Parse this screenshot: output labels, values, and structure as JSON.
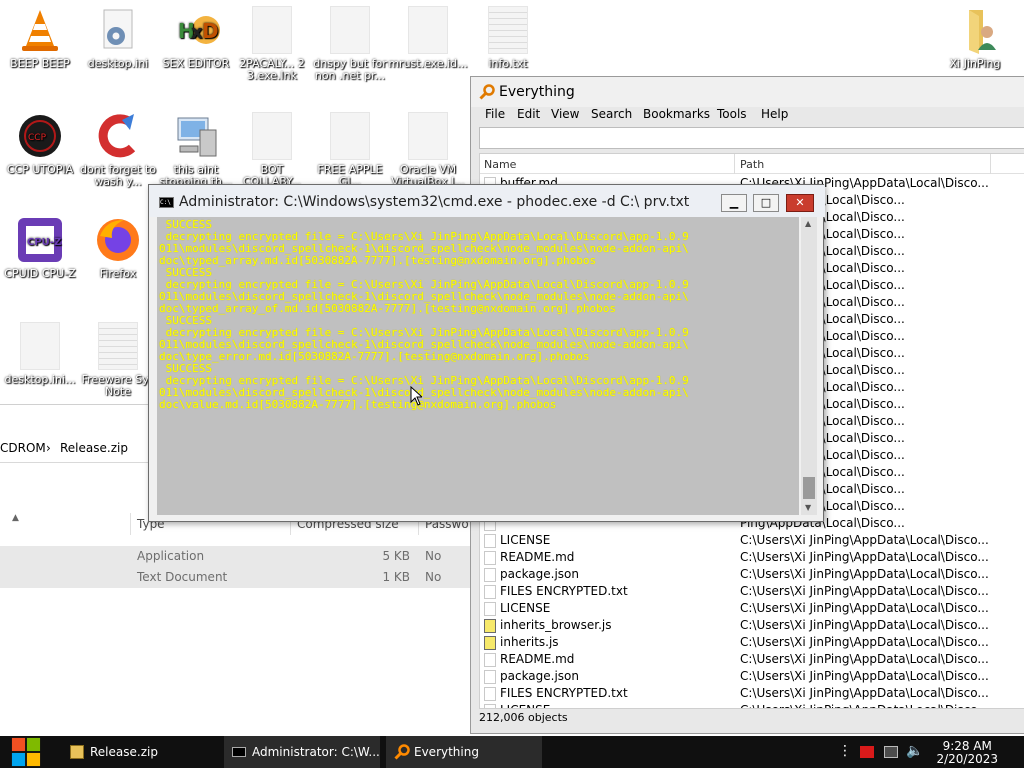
{
  "desktop": {
    "icons": [
      {
        "label": "BEEP BEEP",
        "icon": "vlc-icon"
      },
      {
        "label": "desktop.ini",
        "icon": "settings-file-icon"
      },
      {
        "label": "SEX EDITOR",
        "icon": "hxd-icon"
      },
      {
        "label": "2PACALY... 2 3.exe.lnk",
        "icon": "blank-file-icon"
      },
      {
        "label": "dnspy but for non .net pr...",
        "icon": "blank-file-icon"
      },
      {
        "label": "mrust.exe.id...",
        "icon": "blank-file-icon"
      },
      {
        "label": "info.txt",
        "icon": "text-file-icon"
      },
      {
        "label": "Xi JinPing",
        "icon": "user-folder-icon"
      },
      {
        "label": "CCP UTOPIA",
        "icon": "ccp-icon"
      },
      {
        "label": "dont forget to wash y...",
        "icon": "ccleaner-icon"
      },
      {
        "label": "this aint stopping th...",
        "icon": "computer-icon"
      },
      {
        "label": "BOT COLLABY...",
        "icon": "blank-file-icon"
      },
      {
        "label": "FREE APPLE GI...",
        "icon": "blank-file-icon"
      },
      {
        "label": "Oracle VM VirtualBox I...",
        "icon": "blank-file-icon"
      },
      {
        "label": "CPUID CPU-Z",
        "icon": "cpuz-icon"
      },
      {
        "label": "Firefox",
        "icon": "firefox-icon"
      },
      {
        "label": "desktop.ini...",
        "icon": "blank-file-icon"
      },
      {
        "label": "Freeware Sys Note",
        "icon": "text-file-icon"
      }
    ]
  },
  "explorer": {
    "breadcrumb": "CDROM",
    "breadcrumb_current": "Release.zip",
    "columns": [
      "Type",
      "Compressed size",
      "Passwo"
    ],
    "rows": [
      {
        "type": "Application",
        "size": "5 KB",
        "password": "No"
      },
      {
        "type": "Text Document",
        "size": "1 KB",
        "password": "No"
      }
    ]
  },
  "everything": {
    "title": "Everything",
    "menu": [
      "File",
      "Edit",
      "View",
      "Search",
      "Bookmarks",
      "Tools",
      "Help"
    ],
    "search_value": "",
    "columns": {
      "name": "Name",
      "path": "Path"
    },
    "rows": [
      {
        "name": "buffer.md",
        "path": "C:\\Users\\Xi JinPing\\AppData\\Local\\Disco...",
        "icon": "blank"
      },
      {
        "name": "",
        "path": "Ping\\AppData\\Local\\Disco...",
        "icon": "blank"
      },
      {
        "name": "",
        "path": "Ping\\AppData\\Local\\Disco...",
        "icon": "blank"
      },
      {
        "name": "",
        "path": "Ping\\AppData\\Local\\Disco...",
        "icon": "blank"
      },
      {
        "name": "",
        "path": "Ping\\AppData\\Local\\Disco...",
        "icon": "blank"
      },
      {
        "name": "",
        "path": "Ping\\AppData\\Local\\Disco...",
        "icon": "blank"
      },
      {
        "name": "",
        "path": "Ping\\AppData\\Local\\Disco...",
        "icon": "blank"
      },
      {
        "name": "",
        "path": "Ping\\AppData\\Local\\Disco...",
        "icon": "blank"
      },
      {
        "name": "",
        "path": "Ping\\AppData\\Local\\Disco...",
        "icon": "blank"
      },
      {
        "name": "",
        "path": "Ping\\AppData\\Local\\Disco...",
        "icon": "blank"
      },
      {
        "name": "",
        "path": "Ping\\AppData\\Local\\Disco...",
        "icon": "blank"
      },
      {
        "name": "",
        "path": "Ping\\AppData\\Local\\Disco...",
        "icon": "blank"
      },
      {
        "name": "",
        "path": "Ping\\AppData\\Local\\Disco...",
        "icon": "blank"
      },
      {
        "name": "",
        "path": "Ping\\AppData\\Local\\Disco...",
        "icon": "blank"
      },
      {
        "name": "",
        "path": "Ping\\AppData\\Local\\Disco...",
        "icon": "blank"
      },
      {
        "name": "",
        "path": "Ping\\AppData\\Local\\Disco...",
        "icon": "blank"
      },
      {
        "name": "",
        "path": "Ping\\AppData\\Local\\Disco...",
        "icon": "blank"
      },
      {
        "name": "",
        "path": "Ping\\AppData\\Local\\Disco...",
        "icon": "blank"
      },
      {
        "name": "",
        "path": "Ping\\AppData\\Local\\Disco...",
        "icon": "blank"
      },
      {
        "name": "",
        "path": "Ping\\AppData\\Local\\Disco...",
        "icon": "blank"
      },
      {
        "name": "",
        "path": "Ping\\AppData\\Local\\Disco...",
        "icon": "blank"
      },
      {
        "name": "LICENSE",
        "path": "C:\\Users\\Xi JinPing\\AppData\\Local\\Disco...",
        "icon": "blank"
      },
      {
        "name": "README.md",
        "path": "C:\\Users\\Xi JinPing\\AppData\\Local\\Disco...",
        "icon": "blank"
      },
      {
        "name": "package.json",
        "path": "C:\\Users\\Xi JinPing\\AppData\\Local\\Disco...",
        "icon": "blank"
      },
      {
        "name": "FILES ENCRYPTED.txt",
        "path": "C:\\Users\\Xi JinPing\\AppData\\Local\\Disco...",
        "icon": "blank"
      },
      {
        "name": "LICENSE",
        "path": "C:\\Users\\Xi JinPing\\AppData\\Local\\Disco...",
        "icon": "blank"
      },
      {
        "name": "inherits_browser.js",
        "path": "C:\\Users\\Xi JinPing\\AppData\\Local\\Disco...",
        "icon": "js"
      },
      {
        "name": "inherits.js",
        "path": "C:\\Users\\Xi JinPing\\AppData\\Local\\Disco...",
        "icon": "js"
      },
      {
        "name": "README.md",
        "path": "C:\\Users\\Xi JinPing\\AppData\\Local\\Disco...",
        "icon": "blank"
      },
      {
        "name": "package.json",
        "path": "C:\\Users\\Xi JinPing\\AppData\\Local\\Disco...",
        "icon": "blank"
      },
      {
        "name": "FILES ENCRYPTED.txt",
        "path": "C:\\Users\\Xi JinPing\\AppData\\Local\\Disco...",
        "icon": "blank"
      },
      {
        "name": "LICENSE",
        "path": "C:\\Users\\Xi JinPing\\AppData\\Local\\Disco...",
        "icon": "blank"
      }
    ],
    "status": "212,006 objects"
  },
  "cmd": {
    "title": "Administrator: C:\\Windows\\system32\\cmd.exe - phodec.exe  -d C:\\ prv.txt",
    "lines": [
      " SUCCESS",
      "",
      " decrypting encrypted file = C:\\Users\\Xi JinPing\\AppData\\Local\\Discord\\app-1.0.9",
      "011\\modules\\discord_spellcheck-1\\discord_spellcheck\\node_modules\\node-addon-api\\",
      "doc\\typed_array.md.id[5030882A-7777].[testing@nxdomain.org].phobos",
      " SUCCESS",
      "",
      "",
      " decrypting encrypted file = C:\\Users\\Xi JinPing\\AppData\\Local\\Discord\\app-1.0.9",
      "011\\modules\\discord_spellcheck-1\\discord_spellcheck\\node_modules\\node-addon-api\\",
      "doc\\typed_array_of.md.id[5030882A-7777].[testing@nxdomain.org].phobos",
      " SUCCESS",
      "",
      "",
      " decrypting encrypted file = C:\\Users\\Xi JinPing\\AppData\\Local\\Discord\\app-1.0.9",
      "011\\modules\\discord_spellcheck-1\\discord_spellcheck\\node_modules\\node-addon-api\\",
      "doc\\type_error.md.id[5030882A-7777].[testing@nxdomain.org].phobos",
      " SUCCESS",
      "",
      "",
      " decrypting encrypted file = C:\\Users\\Xi JinPing\\AppData\\Local\\Discord\\app-1.0.9",
      "011\\modules\\discord_spellcheck-1\\discord_spellcheck\\node_modules\\node-addon-api\\",
      "doc\\value.md.id[5030882A-7777].[testing@nxdomain.org].phobos"
    ],
    "colors": {
      "console_bg": "#c0c0c0",
      "console_fg": "#ffff00"
    }
  },
  "taskbar": {
    "items": [
      {
        "label": "Release.zip",
        "icon": "zip-folder-icon"
      },
      {
        "label": "Administrator: C:\\W...",
        "icon": "cmd-icon"
      },
      {
        "label": "Everything",
        "icon": "everything-icon"
      }
    ],
    "time": "9:28 AM",
    "date": "2/20/2023"
  }
}
